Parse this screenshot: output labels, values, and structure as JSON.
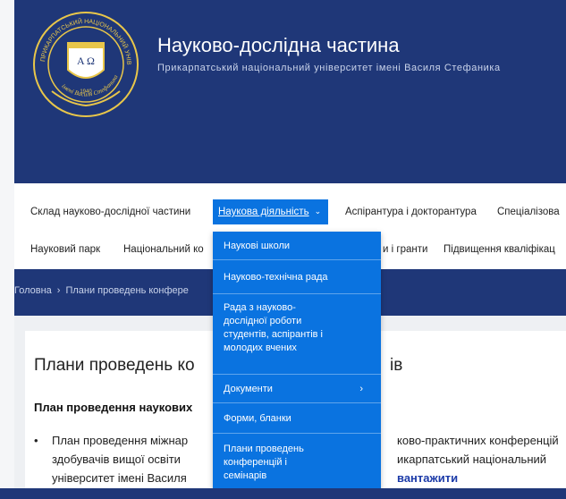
{
  "header": {
    "title": "Науково-дослідна частина",
    "subtitle": "Прикарпатський національний університет імені Василя Стефаника",
    "logo": {
      "ring_text_top": "ПРИКАРПАТСЬКИЙ НАЦІОНАЛЬНИЙ УНІВЕРСИТЕТ",
      "ring_text_bottom": "імені Василя Стефаника",
      "shield_letters": "A Ω",
      "year": "1940"
    }
  },
  "nav": {
    "row1": [
      {
        "label": "Склад науково-дослідної частини"
      },
      {
        "label": "Наукова діяльність",
        "active": true
      },
      {
        "label": "Аспірантура і докторантура"
      },
      {
        "label": "Спеціалізова"
      }
    ],
    "row2": [
      {
        "label": "Науковий парк"
      },
      {
        "label": "Національний ко"
      },
      {
        "label": "и і гранти"
      },
      {
        "label": "Підвищення кваліфікац"
      }
    ],
    "chevron": "⌄"
  },
  "breadcrumb": {
    "home": "Головна",
    "separator": "›",
    "current": "Плани проведень конфере"
  },
  "content": {
    "title_left": "Плани проведень ко",
    "title_right": "ів",
    "section_head": "План проведення наукових",
    "bullet": {
      "line1_left": "План проведення міжнар",
      "line1_right": "ково-практичних конференцій",
      "line2_left": "здобувачів вищої освіти",
      "line2_right": "икарпатський національний",
      "line3_left": "університет імені Василя",
      "line3_right": "вантажити"
    }
  },
  "dropdown": {
    "items": [
      {
        "label": "Наукові школи"
      },
      {
        "label": "Науково-технічна рада"
      },
      {
        "label": "Рада з науково- дослідної роботи студентів, аспірантів і молодих вчених"
      },
      {
        "label": "Документи",
        "arrow": "›"
      },
      {
        "label": "Форми, бланки"
      },
      {
        "label": "Плани проведень конференцій і семінарів"
      }
    ]
  },
  "colors": {
    "header_bg": "#1f3778",
    "accent": "#0a73e0",
    "logo_gold": "#e8c64a"
  }
}
